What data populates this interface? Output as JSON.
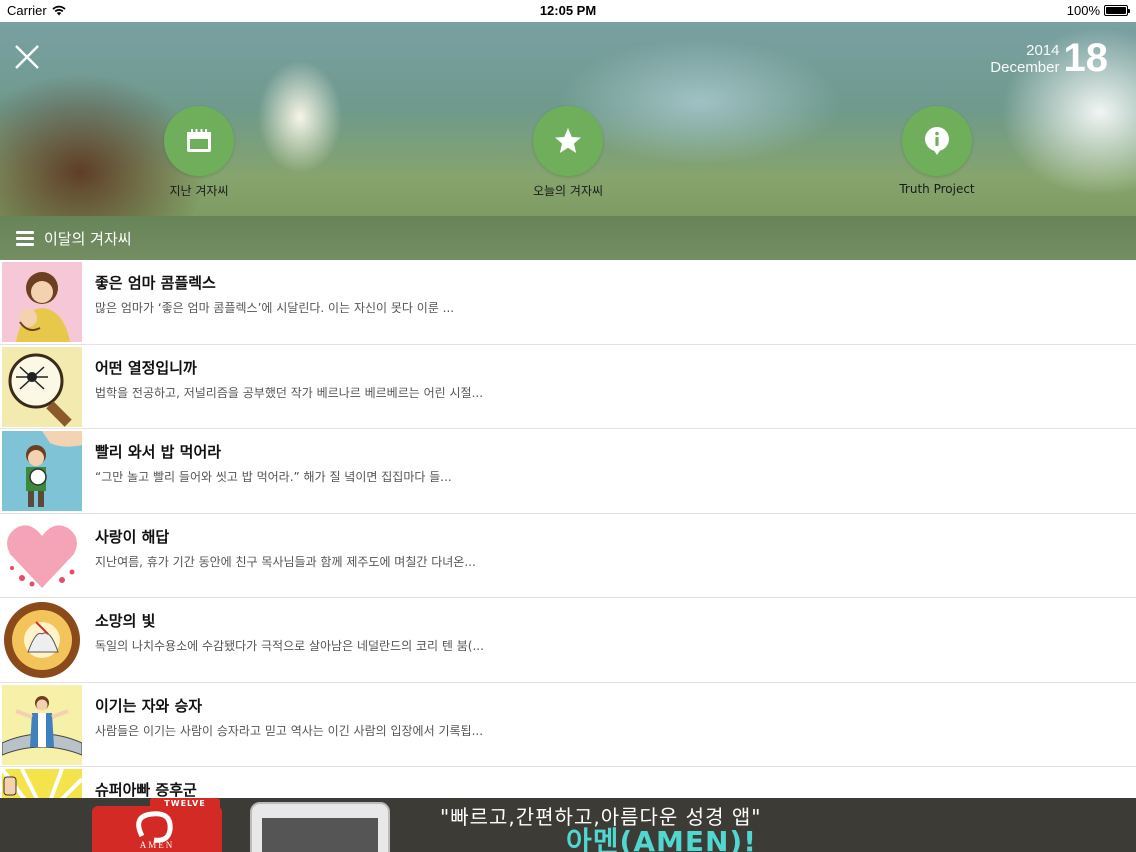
{
  "status_bar": {
    "carrier": "Carrier",
    "time": "12:05 PM",
    "battery": "100%",
    "battery_level": 1.0
  },
  "header": {
    "date": {
      "year": "2014",
      "month": "December",
      "day": "18"
    },
    "nav": [
      {
        "label": "지난 겨자씨",
        "icon": "calendar-icon"
      },
      {
        "label": "오늘의 겨자씨",
        "icon": "star-icon"
      },
      {
        "label": "Truth Project",
        "icon": "info-icon"
      }
    ]
  },
  "section": {
    "title": "이달의 겨자씨"
  },
  "list": [
    {
      "title": "좋은 엄마 콤플렉스",
      "desc": "많은 엄마가 ‘좋은 엄마 콤플렉스’에 시달린다. 이는 자신이 못다 이룬 ..."
    },
    {
      "title": "어떤 열정입니까",
      "desc": "법학을 전공하고, 저널리즘을 공부했던 작가 베르나르 베르베르는 어린 시절..."
    },
    {
      "title": "빨리 와서 밥 먹어라",
      "desc": "“그만 놀고 빨리 들어와 씻고 밥 먹어라.” 해가 질 녘이면 집집마다 들..."
    },
    {
      "title": "사랑이 해답",
      "desc": "지난여름, 휴가 기간 동안에 친구 목사님들과 함께 제주도에 며칠간 다녀온..."
    },
    {
      "title": "소망의 빛",
      "desc": "독일의 나치수용소에 수감됐다가 극적으로 살아남은 네덜란드의 코리 텐 붐(..."
    },
    {
      "title": "이기는 자와 승자",
      "desc": "사람들은 이기는 사람이 승자라고 믿고 역사는 이긴 사람의 입장에서 기록됩..."
    },
    {
      "title": "슈퍼아빠 증후군",
      "desc": ""
    }
  ],
  "ad": {
    "logo_top": "TWELVE",
    "logo_text": "AMEN",
    "line1": "\"빠르고,간편하고,아름다운 성경 앱\"",
    "line2": "아멘(AMEN)!"
  }
}
